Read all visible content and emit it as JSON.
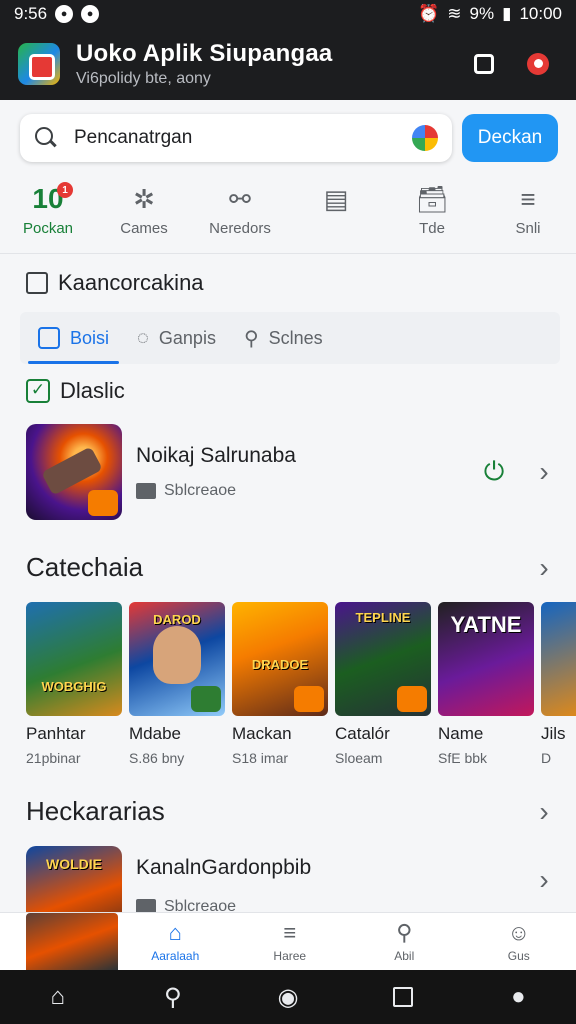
{
  "status_bar": {
    "time_left": "9:56",
    "battery": "9%",
    "time_right": "10:00"
  },
  "app_bar": {
    "title": "Uoko Aplik Siupangaa",
    "subtitle": "Vi6polidy bte, aony",
    "logo_icon": "app-logo"
  },
  "search": {
    "value": "Pencanatrgan",
    "button_label": "Deckan"
  },
  "category_nav": [
    {
      "label": "Pockan",
      "icon": "10",
      "badge": "1",
      "active": true
    },
    {
      "label": "Cames",
      "icon": "✲"
    },
    {
      "label": "Neredors",
      "icon": "⚯"
    },
    {
      "label": "",
      "icon": "▤"
    },
    {
      "label": "Tde",
      "icon": "🗃"
    },
    {
      "label": "Snli",
      "icon": "≡"
    }
  ],
  "section_header": "Kaancorcakina",
  "tabs": [
    {
      "label": "Boisi",
      "active": true
    },
    {
      "label": "Ganpis"
    },
    {
      "label": "Sclnes"
    }
  ],
  "featured": {
    "heading": "Dlaslic",
    "name": "Noikaj Salrunaba",
    "meta": "Sblcreaoe"
  },
  "categories_row": {
    "title": "Catechaia",
    "games": [
      {
        "name": "Panhtar",
        "meta": "21pbinar",
        "art_text": "WOBGHIG",
        "colors": [
          "#1f6fb0",
          "#d88a1e"
        ]
      },
      {
        "name": "Mdabe",
        "meta": "S.86 bny",
        "art_text": "DAROD",
        "colors": [
          "#0d47a1",
          "#e53935"
        ]
      },
      {
        "name": "Mackan",
        "meta": "S18 imar",
        "art_text": "DRADOE",
        "colors": [
          "#f57c00",
          "#5d2a1a"
        ]
      },
      {
        "name": "Catalór",
        "meta": "Sloeam",
        "art_text": "TEPLINE",
        "colors": [
          "#1b5e20",
          "#4a148c"
        ]
      },
      {
        "name": "Name",
        "meta": "SfE bbk",
        "art_text": "YATNE",
        "colors": [
          "#212121",
          "#6a1b9a"
        ]
      },
      {
        "name": "Jils",
        "meta": "D",
        "art_text": "",
        "colors": [
          "#1565c0",
          "#ff8f00"
        ]
      }
    ]
  },
  "second_row": {
    "title": "Heckararias",
    "item_name": "KanalnGardonpbib",
    "item_meta": "Sblcreaoe",
    "art_text": "WOLDIE"
  },
  "app_nav": [
    {
      "label": "Aaralaah",
      "icon": "⌂",
      "active": true
    },
    {
      "label": "Haree",
      "icon": "≡"
    },
    {
      "label": "Abil",
      "icon": "⚲"
    },
    {
      "label": "Gus",
      "icon": "☺"
    }
  ],
  "colors": {
    "accent_blue": "#2196f3",
    "active_green": "#188038",
    "dark_bar": "#1c1d1f"
  }
}
